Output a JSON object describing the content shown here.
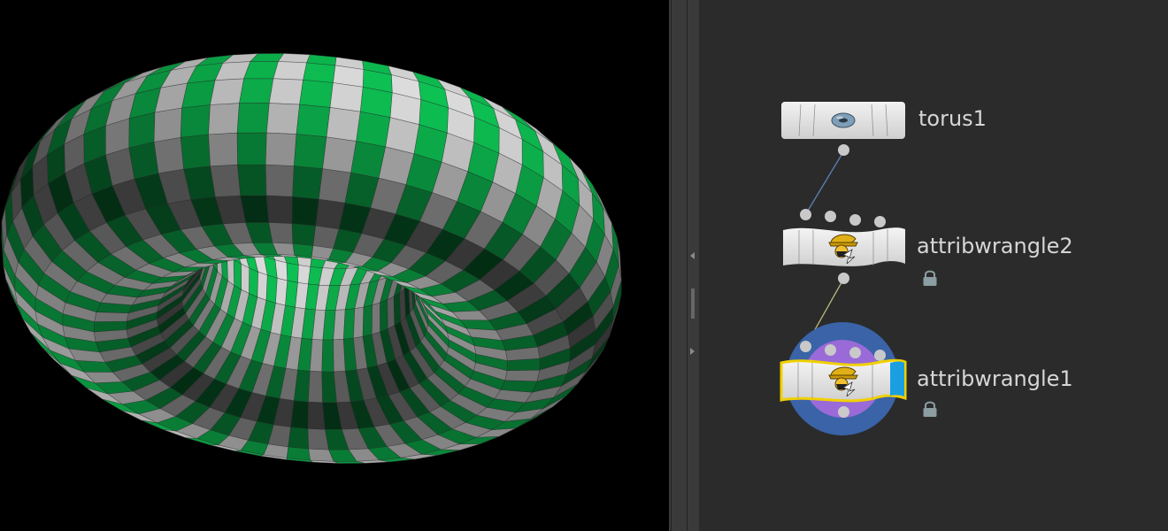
{
  "network": {
    "nodes": [
      {
        "label": "torus1",
        "icon": "torus-icon",
        "locked": false
      },
      {
        "label": "attribwrangle2",
        "icon": "wrangler-icon",
        "locked": true
      },
      {
        "label": "attribwrangle1",
        "icon": "wrangler-icon",
        "locked": true,
        "selected": true,
        "display_flag": true
      }
    ]
  },
  "colors": {
    "stripe_green": "#0cb04c",
    "stripe_grey": "#c8c8c8",
    "viewport_bg": "#000000",
    "network_bg": "#2b2b2b",
    "wire_blue": "#5b7fb8",
    "wire_yellow": "#b8b77a",
    "selection_yellow": "#f0d000",
    "display_flag_blue": "#1aa0e0",
    "ring_blue": "#3a63a8",
    "ring_purple": "#9a6ad8"
  }
}
